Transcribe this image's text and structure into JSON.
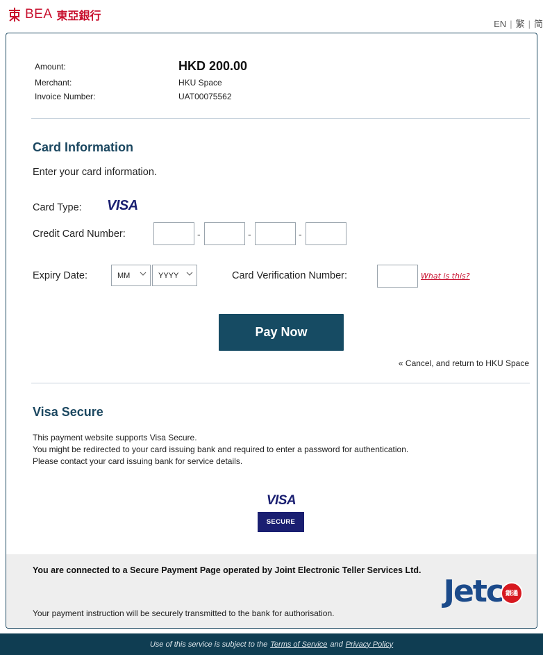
{
  "header": {
    "brand_en": "BEA",
    "brand_cn": "東亞銀行",
    "lang_en": "EN",
    "lang_tc": "繁",
    "lang_sc": "简"
  },
  "order": {
    "amount_label": "Amount:",
    "amount_value": "HKD 200.00",
    "merchant_label": "Merchant:",
    "merchant_value": "HKU Space",
    "invoice_label": "Invoice Number:",
    "invoice_value": "UAT00075562"
  },
  "card_info": {
    "title": "Card Information",
    "instruction": "Enter your card information.",
    "card_type_label": "Card Type:",
    "card_type_value": "VISA",
    "card_number_label": "Credit Card Number:",
    "card_number_separator": "-",
    "card_number_groups": [
      "",
      "",
      "",
      ""
    ],
    "expiry_label": "Expiry Date:",
    "expiry_month": "MM",
    "expiry_year": "YYYY",
    "cvn_label": "Card Verification Number:",
    "cvn_value": "",
    "what_is_this": "What is this?",
    "pay_button": "Pay Now",
    "cancel_link": "« Cancel, and return to HKU Space"
  },
  "visa_secure": {
    "title": "Visa Secure",
    "line1": "This payment website supports Visa Secure.",
    "line2": "You might be redirected to your card issuing bank and required to enter a password for authentication.",
    "line3": "Please contact your card issuing bank for service details.",
    "logo_word": "VISA",
    "logo_badge": "SECURE"
  },
  "secure_notice": {
    "bold_text": "You are connected to a Secure Payment Page operated by Joint Electronic Teller Services Ltd.",
    "note": "Your payment instruction will be securely transmitted to the bank for authorisation.",
    "jetco_logo": "Jetc",
    "jetco_badge": "銀通"
  },
  "footer": {
    "prefix": "Use of this service is subject to the",
    "terms": "Terms of Service",
    "and": "and",
    "privacy": "Privacy Policy"
  },
  "colors": {
    "brand_red": "#c8102e",
    "navy": "#1b4760",
    "button": "#164b63",
    "visa_blue": "#1a1f71",
    "footer_bar": "#0f3d52"
  }
}
